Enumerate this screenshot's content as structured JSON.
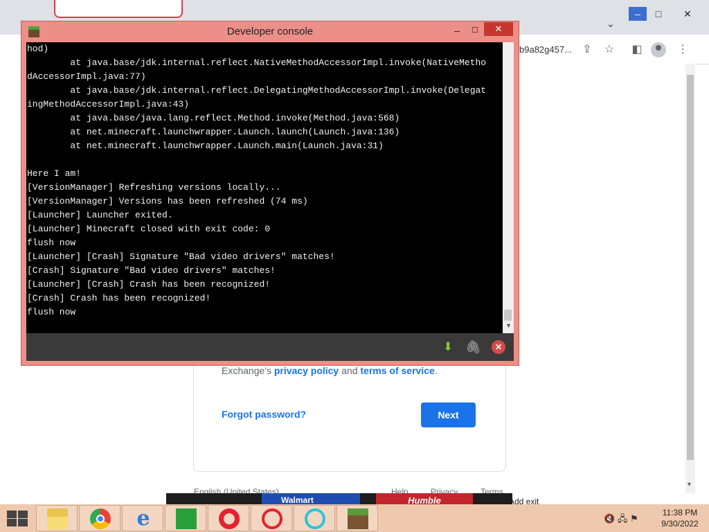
{
  "browser": {
    "url_fragment": "b9a82g457...",
    "window_controls": {
      "minimize": "–",
      "maximize": "□",
      "close": "✕"
    }
  },
  "page": {
    "terms_prefix": "Exchange's ",
    "privacy_link": "privacy policy",
    "terms_mid": " and ",
    "terms_link": "terms of service",
    "terms_suffix": ".",
    "forgot_password": "Forgot password?",
    "next_label": "Next",
    "footer": {
      "language": "English (United States)",
      "help": "Help",
      "privacy": "Privacy",
      "terms": "Terms"
    },
    "ads": {
      "walmart": "Walmart",
      "humble": "Humble",
      "right": "Add exit"
    }
  },
  "console": {
    "title": "Developer console",
    "controls": {
      "minimize": "–",
      "maximize": "☐",
      "close": "✕"
    },
    "lines": [
      "hod)",
      "        at java.base/jdk.internal.reflect.NativeMethodAccessorImpl.invoke(NativeMetho",
      "dAccessorImpl.java:77)",
      "        at java.base/jdk.internal.reflect.DelegatingMethodAccessorImpl.invoke(Delegat",
      "ingMethodAccessorImpl.java:43)",
      "        at java.base/java.lang.reflect.Method.invoke(Method.java:568)",
      "        at net.minecraft.launchwrapper.Launch.launch(Launch.java:136)",
      "        at net.minecraft.launchwrapper.Launch.main(Launch.java:31)",
      "",
      "Here I am!",
      "[VersionManager] Refreshing versions locally...",
      "[VersionManager] Versions has been refreshed (74 ms)",
      "[Launcher] Launcher exited.",
      "[Launcher] Minecraft closed with exit code: 0",
      "flush now",
      "[Launcher] [Crash] Signature \"Bad video drivers\" matches!",
      "[Crash] Signature \"Bad video drivers\" matches!",
      "[Launcher] [Crash] Crash has been recognized!",
      "[Crash] Crash has been recognized!",
      "flush now"
    ]
  },
  "taskbar": {
    "apps": [
      "file-explorer",
      "chrome",
      "internet-explorer",
      "store",
      "opera",
      "opera-gx",
      "opera-ring",
      "minecraft-launcher"
    ],
    "time": "11:38 PM",
    "date": "9/30/2022"
  }
}
